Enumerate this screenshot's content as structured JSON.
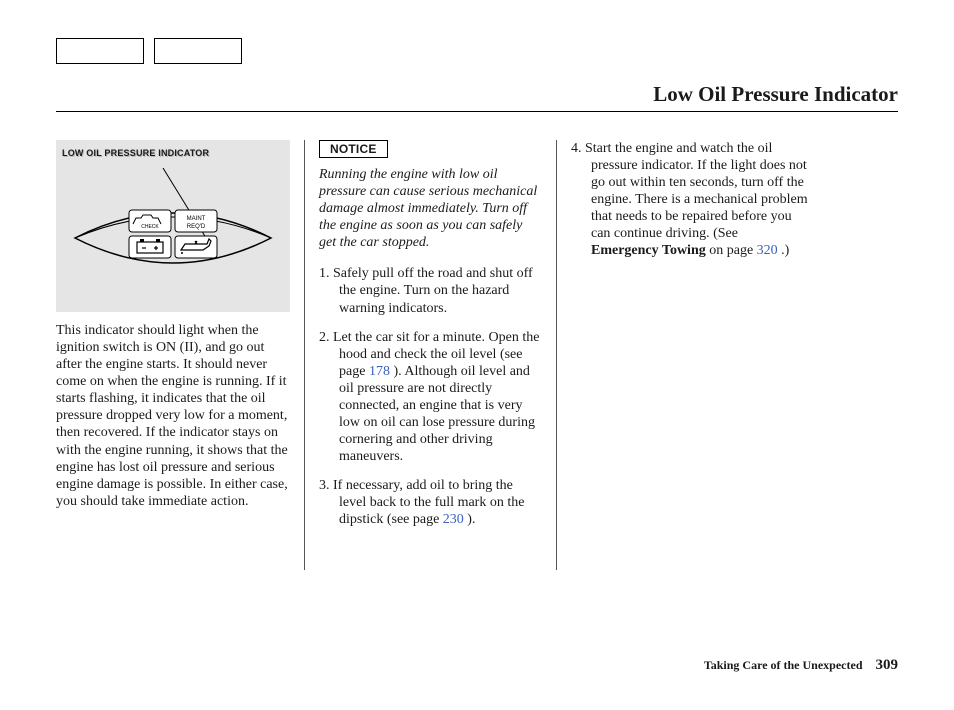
{
  "title": "Low Oil Pressure Indicator",
  "figure": {
    "caption": "LOW OIL PRESSURE INDICATOR",
    "labels": {
      "check": "CHECK",
      "maint": "MAINT REQ'D"
    }
  },
  "col1_text": "This indicator should light when the ignition switch is ON (II), and go out after the engine starts. It should never come on when the engine is running. If it starts flashing, it indicates that the oil pressure dropped very low for a moment, then recovered. If the indicator stays on with the engine running, it shows that the engine has lost oil pressure and serious engine damage is possible. In either case, you should take immediate action.",
  "notice_label": "NOTICE",
  "notice_text": "Running the engine with low oil pressure can cause serious mechanical damage almost immediately. Turn off the engine as soon as you can safely get the car stopped.",
  "steps": {
    "s1": "1.  Safely pull off the road and shut off the engine. Turn on the hazard warning indicators.",
    "s2a": "2.  Let the car sit for a minute. Open the hood and check the oil level (see page ",
    "s2_ref": "178",
    "s2b": " ). Although oil level and oil pressure are not directly connected, an engine that is very low on oil can lose pressure during cornering and other driving maneuvers.",
    "s3a": "3.  If necessary, add oil to bring the level back to the full mark on the dipstick (see page ",
    "s3_ref": "230",
    "s3b": " ).",
    "s4a": "4.  Start the engine and watch the oil pressure indicator. If the light does not go out within ten seconds, turn off the engine. There is a mechanical problem that needs to be repaired before you can continue driving. (See ",
    "s4_bold": "Emergency Towing",
    "s4b": " on page ",
    "s4_ref": "320",
    "s4c": " .)"
  },
  "footer": {
    "section": "Taking Care of the Unexpected",
    "page": "309"
  }
}
